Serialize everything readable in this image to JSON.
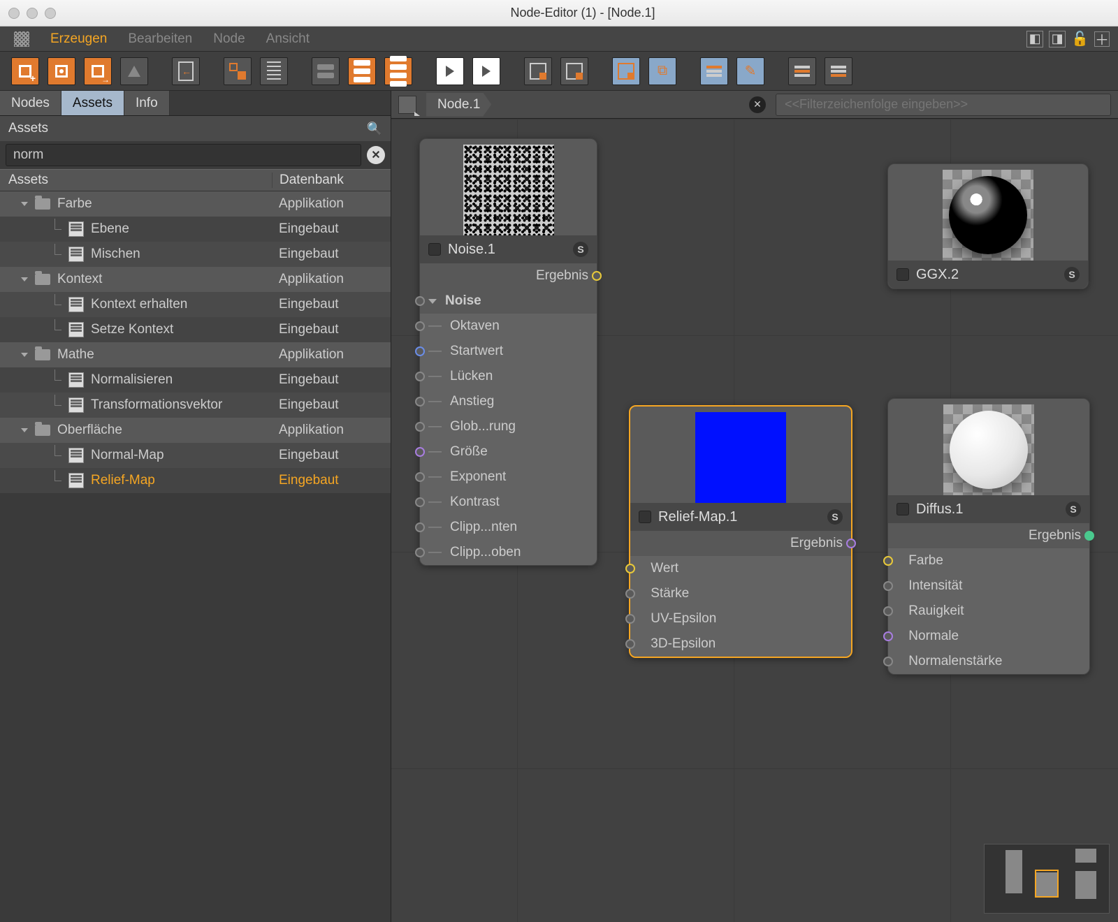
{
  "window": {
    "title": "Node-Editor (1) - [Node.1]"
  },
  "menu": {
    "items": [
      "Erzeugen",
      "Bearbeiten",
      "Node",
      "Ansicht"
    ],
    "active_index": 0
  },
  "sidebar": {
    "tabs": [
      "Nodes",
      "Assets",
      "Info"
    ],
    "active_tab": 1,
    "panel_title": "Assets",
    "filter_value": "norm",
    "columns": [
      "Assets",
      "Datenbank"
    ],
    "tree": [
      {
        "type": "cat",
        "label": "Farbe",
        "db": "Applikation"
      },
      {
        "type": "item",
        "label": "Ebene",
        "db": "Eingebaut"
      },
      {
        "type": "item",
        "label": "Mischen",
        "db": "Eingebaut"
      },
      {
        "type": "cat",
        "label": "Kontext",
        "db": "Applikation"
      },
      {
        "type": "item",
        "label": "Kontext erhalten",
        "db": "Eingebaut"
      },
      {
        "type": "item",
        "label": "Setze Kontext",
        "db": "Eingebaut"
      },
      {
        "type": "cat",
        "label": "Mathe",
        "db": "Applikation"
      },
      {
        "type": "item",
        "label": "Normalisieren",
        "db": "Eingebaut"
      },
      {
        "type": "item",
        "label": "Transformationsvektor",
        "db": "Eingebaut"
      },
      {
        "type": "cat",
        "label": "Oberfläche",
        "db": "Applikation"
      },
      {
        "type": "item",
        "label": "Normal-Map",
        "db": "Eingebaut"
      },
      {
        "type": "item",
        "label": "Relief-Map",
        "db": "Eingebaut",
        "hl": true
      }
    ]
  },
  "graph": {
    "breadcrumb": "Node.1",
    "filter_placeholder": "<<Filterzeichenfolge eingeben>>",
    "nodes": {
      "noise": {
        "title": "Noise.1",
        "output": "Ergebnis",
        "group": "Noise",
        "inputs": [
          {
            "label": "Oktaven",
            "port": "grey"
          },
          {
            "label": "Startwert",
            "port": "blue"
          },
          {
            "label": "Lücken",
            "port": "grey"
          },
          {
            "label": "Anstieg",
            "port": "grey"
          },
          {
            "label": "Glob...rung",
            "port": "grey"
          },
          {
            "label": "Größe",
            "port": "purple"
          },
          {
            "label": "Exponent",
            "port": "grey"
          },
          {
            "label": "Kontrast",
            "port": "grey"
          },
          {
            "label": "Clipp...nten",
            "port": "grey"
          },
          {
            "label": "Clipp...oben",
            "port": "grey"
          }
        ]
      },
      "relief": {
        "title": "Relief-Map.1",
        "output": "Ergebnis",
        "inputs": [
          {
            "label": "Wert",
            "port": "yellow"
          },
          {
            "label": "Stärke",
            "port": "grey"
          },
          {
            "label": "UV-Epsilon",
            "port": "grey"
          },
          {
            "label": "3D-Epsilon",
            "port": "grey"
          }
        ]
      },
      "ggx": {
        "title": "GGX.2"
      },
      "diffus": {
        "title": "Diffus.1",
        "output": "Ergebnis",
        "inputs": [
          {
            "label": "Farbe",
            "port": "yellow"
          },
          {
            "label": "Intensität",
            "port": "grey"
          },
          {
            "label": "Rauigkeit",
            "port": "grey"
          },
          {
            "label": "Normale",
            "port": "purple"
          },
          {
            "label": "Normalenstärke",
            "port": "grey"
          }
        ]
      }
    }
  }
}
